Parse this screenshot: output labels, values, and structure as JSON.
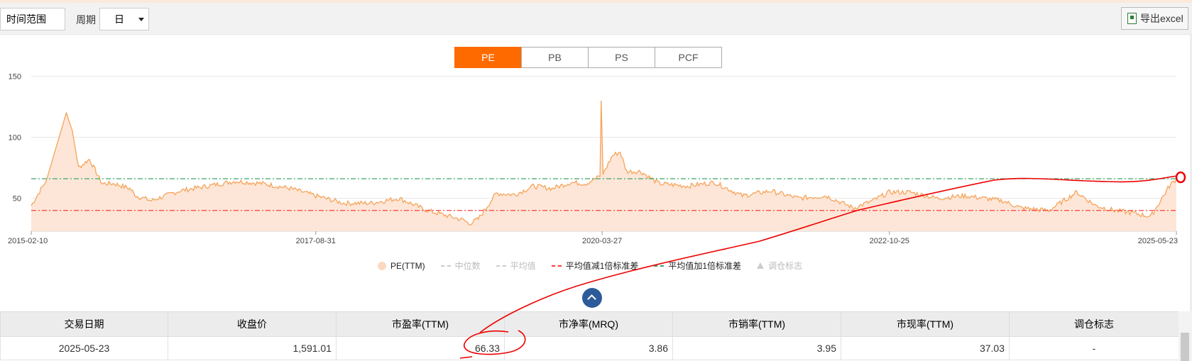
{
  "toolbar": {
    "range_label": "时间范围",
    "period_label": "周期",
    "period_value": "日",
    "export_label": "导出excel"
  },
  "tabs": [
    {
      "label": "PE",
      "active": true
    },
    {
      "label": "PB",
      "active": false
    },
    {
      "label": "PS",
      "active": false
    },
    {
      "label": "PCF",
      "active": false
    }
  ],
  "chart_data": {
    "type": "area",
    "title": "",
    "xlabel": "",
    "ylabel": "",
    "ylim": [
      23,
      152
    ],
    "y_ticks": [
      50,
      100,
      150
    ],
    "x_tick_labels": [
      "2015-02-10",
      "2017-08-31",
      "2020-03-27",
      "2022-10-25",
      "2025-05-23"
    ],
    "grid": "horizontal",
    "legend_position": "bottom",
    "series": [
      {
        "name": "PE(TTM)",
        "color": "#f5a45b",
        "fill": "#fde6d7",
        "x": [
          "2015-02-10",
          "2015-04-01",
          "2015-06-05",
          "2015-06-25",
          "2015-07-15",
          "2015-08-20",
          "2015-09-30",
          "2015-11-10",
          "2015-12-30",
          "2016-01-20",
          "2016-03-10",
          "2016-06-10",
          "2016-09-10",
          "2016-12-10",
          "2017-03-10",
          "2017-06-10",
          "2017-08-31",
          "2017-11-30",
          "2018-02-28",
          "2018-05-31",
          "2018-08-31",
          "2018-10-31",
          "2018-12-31",
          "2019-01-15",
          "2019-02-15",
          "2019-04-15",
          "2019-06-15",
          "2019-08-15",
          "2019-10-15",
          "2019-12-15",
          "2020-02-03",
          "2020-03-20",
          "2020-03-24",
          "2020-03-30",
          "2020-04-30",
          "2020-05-25",
          "2020-06-15",
          "2020-07-31",
          "2020-09-30",
          "2020-12-31",
          "2021-03-31",
          "2021-06-30",
          "2021-09-30",
          "2021-12-31",
          "2022-03-31",
          "2022-06-30",
          "2022-08-31",
          "2022-10-25",
          "2022-12-31",
          "2023-03-31",
          "2023-06-30",
          "2023-08-31",
          "2023-10-31",
          "2023-12-31",
          "2024-03-31",
          "2024-06-30",
          "2024-08-31",
          "2024-10-31",
          "2024-12-31",
          "2025-02-28",
          "2025-04-30",
          "2025-05-23"
        ],
        "values": [
          44,
          65,
          120,
          105,
          75,
          82,
          62,
          62,
          58,
          52,
          48,
          56,
          60,
          64,
          62,
          58,
          52,
          46,
          46,
          50,
          40,
          36,
          32,
          29,
          33,
          54,
          53,
          60,
          58,
          63,
          62,
          68,
          130,
          70,
          85,
          88,
          72,
          72,
          62,
          60,
          63,
          52,
          56,
          50,
          52,
          42,
          48,
          55,
          55,
          50,
          52,
          50,
          48,
          42,
          40,
          55,
          44,
          40,
          38,
          35,
          60,
          66
        ]
      },
      {
        "name": "中位数",
        "color": "#cccccc",
        "hidden": true
      },
      {
        "name": "平均值",
        "color": "#cccccc",
        "hidden": true
      },
      {
        "name": "平均值减1倍标准差",
        "color": "#ff3b3b",
        "value": 40
      },
      {
        "name": "平均值加1倍标准差",
        "color": "#3aa86b",
        "value": 66
      },
      {
        "name": "调仓标志",
        "color": "#cccccc",
        "hidden": true
      }
    ]
  },
  "table": {
    "columns": [
      "交易日期",
      "收盘价",
      "市盈率(TTM)",
      "市净率(MRQ)",
      "市销率(TTM)",
      "市现率(TTM)",
      "调仓标志"
    ],
    "rows": [
      [
        "2025-05-23",
        "1,591.01",
        "66.33",
        "3.86",
        "3.95",
        "37.03",
        "-"
      ]
    ]
  },
  "annotation_color": "#ee0000"
}
